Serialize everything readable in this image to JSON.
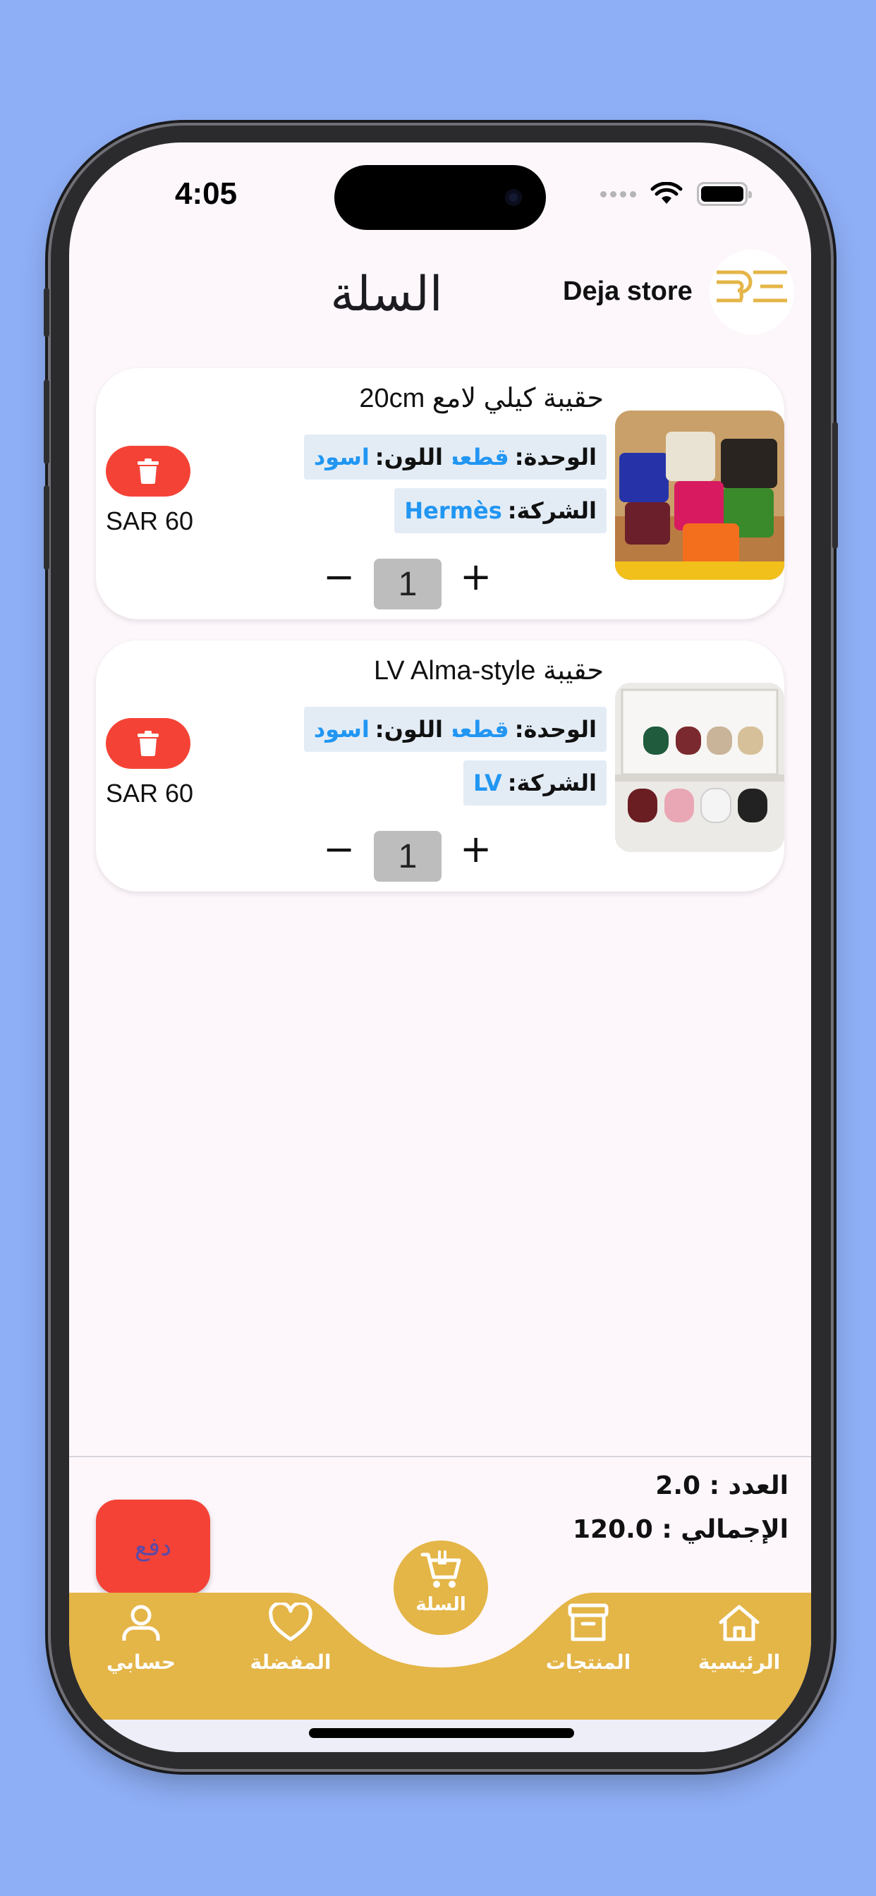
{
  "status_bar": {
    "time": "4:05"
  },
  "header": {
    "title": "السلة",
    "store_name": "Deja store"
  },
  "cart": {
    "items": [
      {
        "title": "حقيبة كيلي لامع 20cm",
        "unit_label": "الوحدة:",
        "unit_value": "قطعه",
        "color_label": "اللون:",
        "color_value": "اسود",
        "brand_label": "الشركة:",
        "brand_value": "Hermès",
        "price": "SAR 60",
        "quantity": "1",
        "minus": "−",
        "plus": "+"
      },
      {
        "title": "حقيبة LV Alma-style",
        "unit_label": "الوحدة:",
        "unit_value": "قطعه",
        "color_label": "اللون:",
        "color_value": "اسود",
        "brand_label": "الشركة:",
        "brand_value": "LV",
        "price": "SAR 60",
        "quantity": "1",
        "minus": "−",
        "plus": "+"
      }
    ]
  },
  "summary": {
    "count_text": "العدد : 2.0",
    "total_text": "الإجمالي : 120.0"
  },
  "pay_button": {
    "label": "دفع"
  },
  "bottom_nav": {
    "home": "الرئيسية",
    "products": "المنتجات",
    "cart": "السلة",
    "favorites": "المفضلة",
    "account": "حسابي"
  },
  "colors": {
    "background": "#8eaef5",
    "accent_gold": "#e4b547",
    "delete_red": "#f44336",
    "link_blue": "#2196f3",
    "chip_bg": "#e3ecf5"
  },
  "icons": {
    "delete": "trash-icon",
    "home": "home-icon",
    "products": "archive-box-icon",
    "cart": "cart-add-icon",
    "favorites": "heart-icon",
    "account": "person-icon"
  }
}
